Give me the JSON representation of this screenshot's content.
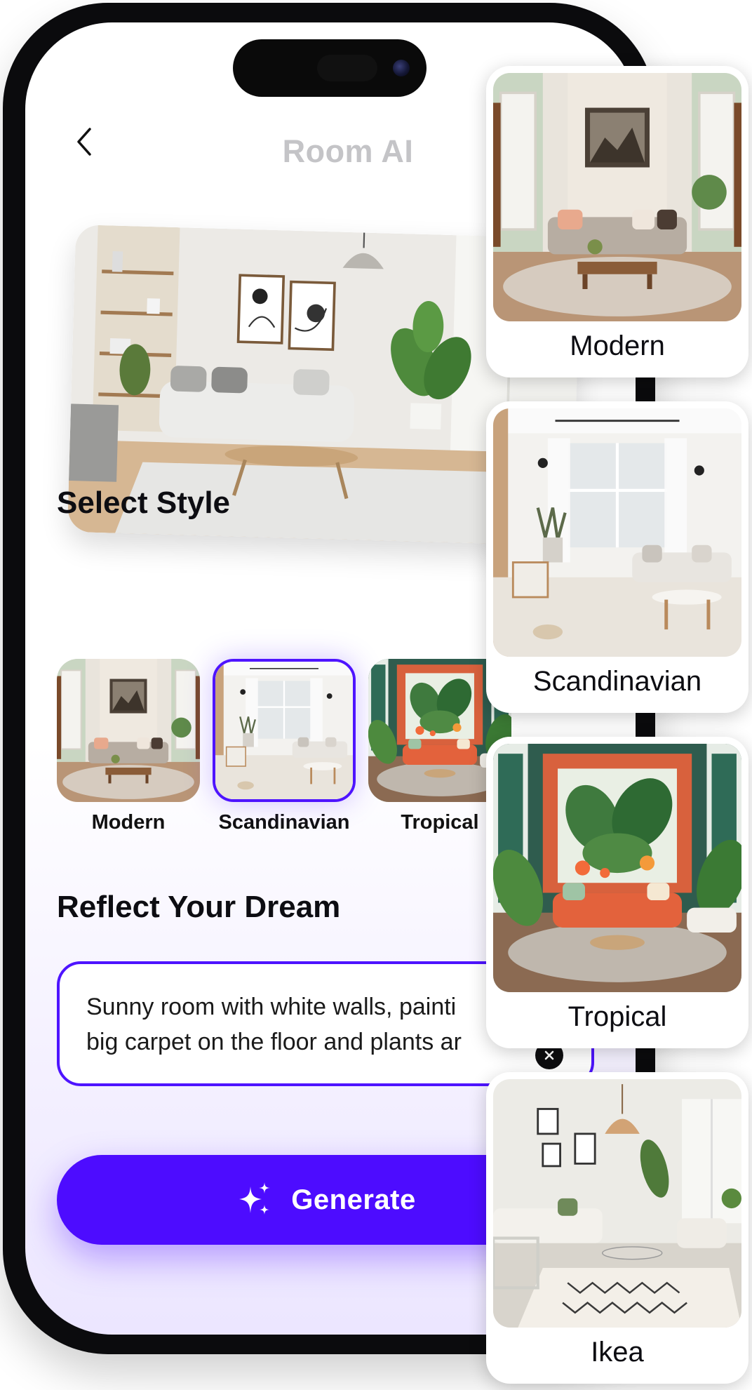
{
  "header": {
    "title": "Room AI"
  },
  "sections": {
    "select_style": "Select Style",
    "reflect_dream": "Reflect Your Dream"
  },
  "style_options": [
    {
      "label": "Modern",
      "selected": false
    },
    {
      "label": "Scandinavian",
      "selected": true
    },
    {
      "label": "Tropical",
      "selected": false
    }
  ],
  "prompt": {
    "text": "Sunny room with white walls, painti\nbig carpet on the floor and plants ar"
  },
  "generate_button": {
    "label": "Generate"
  },
  "style_cards": [
    {
      "label": "Modern"
    },
    {
      "label": "Scandinavian"
    },
    {
      "label": "Tropical"
    },
    {
      "label": "Ikea"
    }
  ],
  "colors": {
    "accent": "#4d0cff",
    "title_muted": "#c4c4c7"
  },
  "icons": {
    "back": "chevron-left-icon",
    "generate": "sparkles-icon",
    "clear": "close-icon"
  }
}
